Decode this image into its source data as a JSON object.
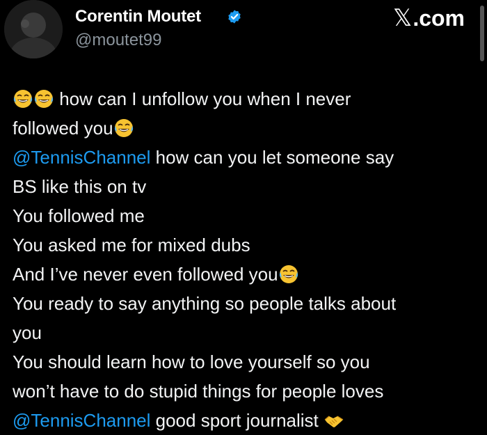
{
  "profile": {
    "display_name": "Corentin Moutet",
    "handle": "@moutet99",
    "verified": true,
    "verified_color": "#1d9bf0"
  },
  "brand": {
    "glyph": "𝕏",
    "suffix": ".com"
  },
  "tweet": {
    "line1_text": " how can I unfollow you when I never",
    "line2_text": "followed you",
    "line3_mention": "@TennisChannel",
    "line3_text": " how can you let someone say",
    "line4_text": "BS like this on tv",
    "line5_text": "You followed me",
    "line6_text": "You asked me for mixed dubs",
    "line7_text": "And I’ve never even followed you",
    "line8_text": "You ready to say anything so people talks about",
    "line9_text": "you",
    "line10_text": "You should learn how to love yourself so you",
    "line11_text": "won’t have to do stupid things for people loves",
    "line12_mention": "@TennisChannel",
    "line12_text": " good sport journalist "
  },
  "icons": {
    "laughing": "face-with-tears-of-joy-emoji",
    "handshake": "handshake-emoji",
    "verified": "verified-badge-icon"
  },
  "colors": {
    "background": "#000000",
    "text": "#f3f4f5",
    "secondary_text": "#8b949c",
    "mention": "#1d9bf0"
  }
}
